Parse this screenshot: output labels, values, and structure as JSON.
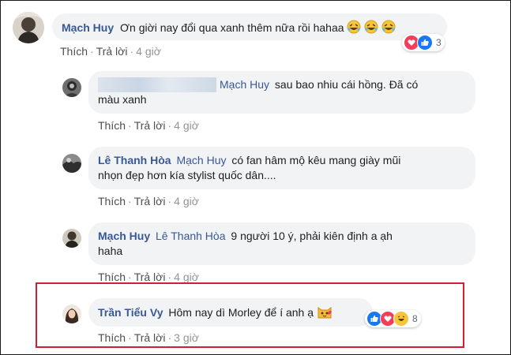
{
  "comments": [
    {
      "author": "Mạch Huy",
      "text": "Ơn giời nay đổi qua xanh thêm nữa rồi hahaa",
      "emoji": [
        "rofl-emoji",
        "rofl-emoji",
        "rofl-emoji"
      ],
      "reactions": {
        "icons": [
          "love-reaction-icon",
          "like-reaction-icon"
        ],
        "count": "3"
      },
      "like": "Thích",
      "reply": "Trả lời",
      "time": "4 giờ"
    }
  ],
  "replies": [
    {
      "author_redacted": true,
      "mention": "Mạch Huy",
      "text_line1": "sau bao nhiu cái hồng. Đã có",
      "text_line2": "màu xanh",
      "like": "Thích",
      "reply": "Trả lời",
      "time": "4 giờ"
    },
    {
      "author": "Lê Thanh Hòa",
      "mention": "Mạch Huy",
      "text_line1": "có fan hâm mộ kêu mang giày mũi",
      "text_line2": "nhọn đẹp hơn kía stylist quốc dân....",
      "like": "Thích",
      "reply": "Trả lời",
      "time": "4 giờ"
    },
    {
      "author": "Mạch Huy",
      "mention": "Lê Thanh Hòa",
      "text_line1": "9 người 10 ý, phải kiên định a ạh",
      "text_line2": "haha",
      "like": "Thích",
      "reply": "Trả lời",
      "time": "4 giờ"
    },
    {
      "author": "Trần Tiểu Vy",
      "text": "Hôm nay dì Morley để í anh ạ",
      "emoji": "cat-emoji",
      "reactions": {
        "icons": [
          "like-reaction-icon",
          "love-reaction-icon",
          "haha-reaction-icon"
        ],
        "count": "8"
      },
      "like": "Thích",
      "reply": "Trả lời",
      "time": "3 giờ"
    }
  ],
  "colors": {
    "author": "#385898",
    "bubble": "#f2f3f5",
    "highlight": "#d1202f"
  }
}
